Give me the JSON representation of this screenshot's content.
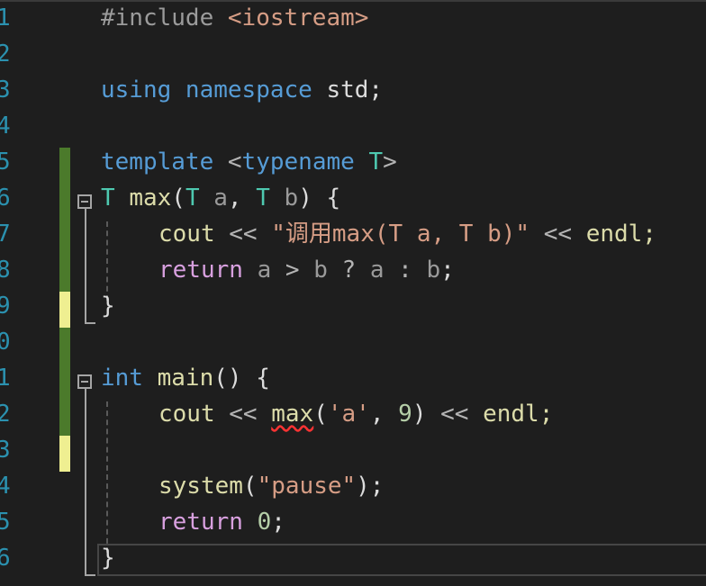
{
  "editor": {
    "lines": [
      {
        "num": "1",
        "indent": 0,
        "tokens": [
          {
            "t": "#include ",
            "c": "pp"
          },
          {
            "t": "<iostream>",
            "c": "str"
          }
        ]
      },
      {
        "num": "2",
        "indent": 0,
        "tokens": []
      },
      {
        "num": "3",
        "indent": 0,
        "tokens": [
          {
            "t": "using ",
            "c": "kw"
          },
          {
            "t": "namespace ",
            "c": "kw"
          },
          {
            "t": "std;",
            "c": "plain"
          }
        ]
      },
      {
        "num": "4",
        "indent": 0,
        "tokens": []
      },
      {
        "num": "5",
        "indent": 0,
        "tokens": [
          {
            "t": "template ",
            "c": "kw"
          },
          {
            "t": "<",
            "c": "op"
          },
          {
            "t": "typename ",
            "c": "kw"
          },
          {
            "t": "T",
            "c": "type"
          },
          {
            "t": ">",
            "c": "op"
          }
        ]
      },
      {
        "num": "6",
        "indent": 0,
        "tokens": [
          {
            "t": "T ",
            "c": "type"
          },
          {
            "t": "max",
            "c": "fn"
          },
          {
            "t": "(",
            "c": "plain"
          },
          {
            "t": "T ",
            "c": "type"
          },
          {
            "t": "a",
            "c": "param"
          },
          {
            "t": ", ",
            "c": "plain"
          },
          {
            "t": "T ",
            "c": "type"
          },
          {
            "t": "b",
            "c": "param"
          },
          {
            "t": ") {",
            "c": "plain"
          }
        ]
      },
      {
        "num": "7",
        "indent": 1,
        "tokens": [
          {
            "t": "cout ",
            "c": "fn"
          },
          {
            "t": "<< ",
            "c": "op"
          },
          {
            "t": "\"调用max(T a, T b)\"",
            "c": "str"
          },
          {
            "t": " << ",
            "c": "op"
          },
          {
            "t": "endl;",
            "c": "fn"
          }
        ]
      },
      {
        "num": "8",
        "indent": 1,
        "tokens": [
          {
            "t": "return ",
            "c": "ctl"
          },
          {
            "t": "a ",
            "c": "param"
          },
          {
            "t": "> ",
            "c": "op"
          },
          {
            "t": "b ",
            "c": "param"
          },
          {
            "t": "? ",
            "c": "op"
          },
          {
            "t": "a ",
            "c": "param"
          },
          {
            "t": ": ",
            "c": "op"
          },
          {
            "t": "b",
            "c": "param"
          },
          {
            "t": ";",
            "c": "plain"
          }
        ]
      },
      {
        "num": "9",
        "indent": 0,
        "tokens": [
          {
            "t": "}",
            "c": "plain"
          }
        ]
      },
      {
        "num": "0",
        "indent": 0,
        "tokens": []
      },
      {
        "num": "1",
        "indent": 0,
        "tokens": [
          {
            "t": "int ",
            "c": "kw"
          },
          {
            "t": "main",
            "c": "fn"
          },
          {
            "t": "() {",
            "c": "plain"
          }
        ]
      },
      {
        "num": "2",
        "indent": 1,
        "tokens": [
          {
            "t": "cout ",
            "c": "fn"
          },
          {
            "t": "<< ",
            "c": "op"
          },
          {
            "t": "max",
            "c": "fn",
            "squiggle": true
          },
          {
            "t": "(",
            "c": "plain"
          },
          {
            "t": "'a'",
            "c": "str"
          },
          {
            "t": ", ",
            "c": "plain"
          },
          {
            "t": "9",
            "c": "num"
          },
          {
            "t": ") ",
            "c": "plain"
          },
          {
            "t": "<< ",
            "c": "op"
          },
          {
            "t": "endl;",
            "c": "fn"
          }
        ]
      },
      {
        "num": "3",
        "indent": 1,
        "tokens": []
      },
      {
        "num": "4",
        "indent": 1,
        "tokens": [
          {
            "t": "system",
            "c": "fn"
          },
          {
            "t": "(",
            "c": "plain"
          },
          {
            "t": "\"pause\"",
            "c": "str"
          },
          {
            "t": ");",
            "c": "plain"
          }
        ]
      },
      {
        "num": "5",
        "indent": 1,
        "tokens": [
          {
            "t": "return ",
            "c": "ctl"
          },
          {
            "t": "0",
            "c": "num"
          },
          {
            "t": ";",
            "c": "plain"
          }
        ]
      },
      {
        "num": "6",
        "indent": 0,
        "tokens": [
          {
            "t": "}",
            "c": "plain"
          }
        ]
      }
    ],
    "colors": {
      "background": "#1e1e1e",
      "line_number": "#2b91af",
      "change_saved": "#4b7a2b",
      "change_unsaved": "#efef91",
      "squiggle": "#ff3333"
    }
  }
}
